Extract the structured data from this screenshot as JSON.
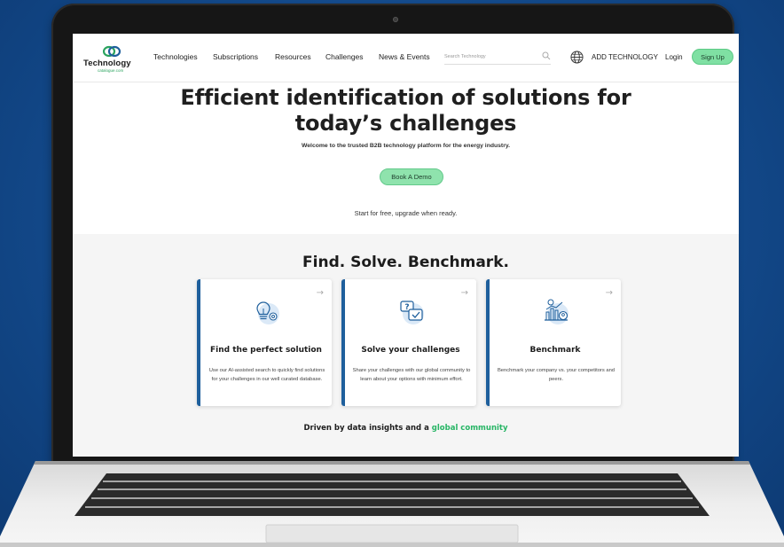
{
  "nav": {
    "logo_text": "Technology",
    "logo_sub": "catalogue.com",
    "links": [
      "Technologies",
      "Subscriptions",
      "Resources",
      "Challenges",
      "News & Events"
    ],
    "search_placeholder": "Search Technology",
    "add_technology": "ADD TECHNOLOGY",
    "login": "Login",
    "signup": "Sign Up"
  },
  "hero": {
    "title_line1": "Efficient identification of solutions for",
    "title_line2": "today’s challenges",
    "subtitle": "Welcome to the trusted B2B technology platform for the energy industry.",
    "cta": "Book A Demo",
    "note": "Start for free, upgrade when ready."
  },
  "section": {
    "title": "Find. Solve. Benchmark.",
    "cards": [
      {
        "title": "Find the perfect solution",
        "desc": "Use our AI-assisted search to quickly find solutions for your challenges in our well curated database.",
        "icon": "lightbulb-gear-icon"
      },
      {
        "title": "Solve your challenges",
        "desc": "Share your challenges with our global community to learn about your options with minimum effort.",
        "icon": "question-check-icon"
      },
      {
        "title": "Benchmark",
        "desc": "Benchmark your company vs. your competitors and peers.",
        "icon": "chart-user-icon"
      }
    ],
    "tagline_prefix": "Driven by data insights and a ",
    "tagline_highlight": "global community"
  },
  "colors": {
    "accent_green": "#7fe0a3",
    "highlight_green": "#27b565",
    "card_border_blue": "#1e5f9c",
    "background_blue": "#134a8c"
  }
}
